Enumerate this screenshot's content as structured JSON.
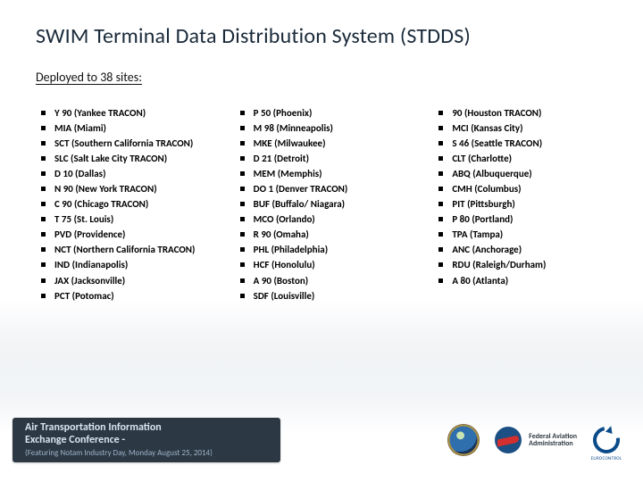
{
  "title": "SWIM Terminal Data Distribution System (STDDS)",
  "subtitle": "Deployed to 38 sites:",
  "columns": [
    [
      "Y 90 (Yankee TRACON)",
      "MIA (Miami)",
      "SCT (Southern California TRACON)",
      "SLC (Salt Lake City TRACON)",
      "D 10 (Dallas)",
      "N 90 (New York TRACON)",
      "C 90 (Chicago TRACON)",
      "T 75 (St. Louis)",
      "PVD (Providence)",
      "NCT (Northern California TRACON)",
      "IND (Indianapolis)",
      "JAX (Jacksonville)",
      "PCT (Potomac)"
    ],
    [
      "P 50 (Phoenix)",
      "M 98 (Minneapolis)",
      "MKE (Milwaukee)",
      "D 21 (Detroit)",
      "MEM (Memphis)",
      "DO 1 (Denver TRACON)",
      "BUF (Buffalo/ Niagara)",
      "MCO (Orlando)",
      "R 90 (Omaha)",
      "PHL (Philadelphia)",
      "HCF (Honolulu)",
      "A 90 (Boston)",
      "SDF (Louisville)"
    ],
    [
      "90 (Houston TRACON)",
      "MCI (Kansas City)",
      "S 46 (Seattle TRACON)",
      "CLT (Charlotte)",
      "ABQ (Albuquerque)",
      "CMH (Columbus)",
      "PIT (Pittsburgh)",
      "P 80 (Portland)",
      "TPA (Tampa)",
      "ANC (Anchorage)",
      "RDU (Raleigh/Durham)",
      "A 80 (Atlanta)"
    ]
  ],
  "footer": {
    "conf_line1": "Air Transportation Information",
    "conf_line2": "Exchange Conference -",
    "conf_sub": "(Featuring Notam Industry Day, Monday August 25, 2014)",
    "faa_line1": "Federal Aviation",
    "faa_line2": "Administration",
    "euro": "EUROCONTROL"
  }
}
